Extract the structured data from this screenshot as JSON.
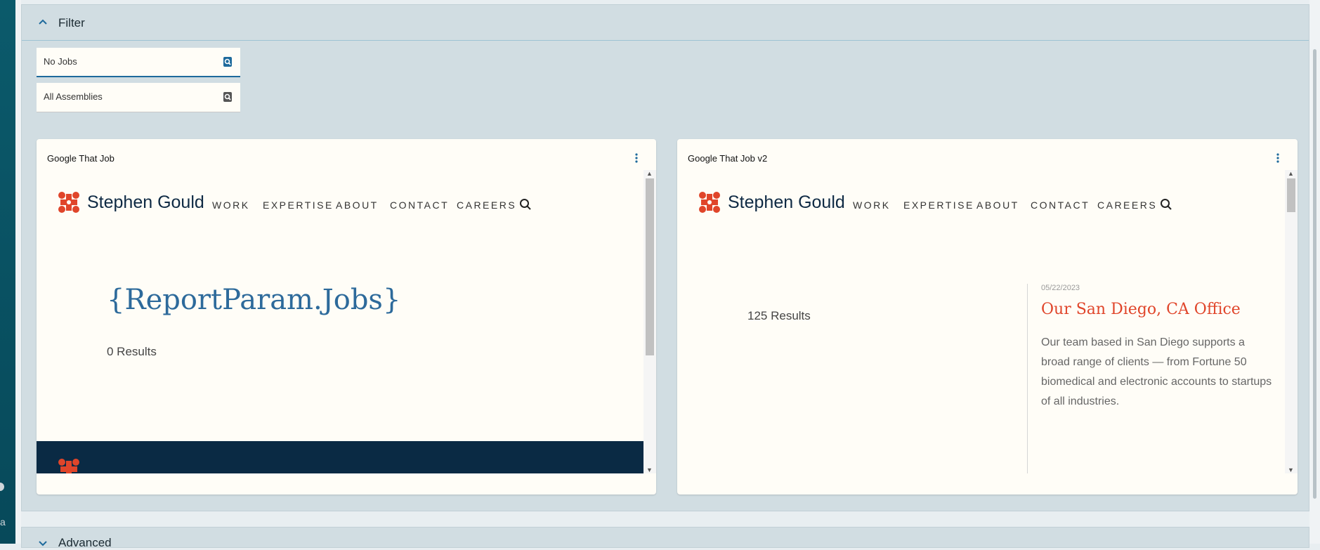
{
  "filter_panel": {
    "title": "Filter",
    "jobs_field": {
      "value": "No Jobs"
    },
    "assemblies_field": {
      "value": "All Assemblies"
    }
  },
  "cards": [
    {
      "title": "Google That Job",
      "site": {
        "brand": "Stephen Gould",
        "nav": [
          "WORK",
          "EXPERTISE",
          "ABOUT",
          "CONTACT",
          "CAREERS"
        ],
        "heading": "{ReportParam.Jobs}",
        "results": "0 Results"
      }
    },
    {
      "title": "Google That Job v2",
      "site": {
        "brand": "Stephen Gould",
        "nav": [
          "WORK",
          "EXPERTISE",
          "ABOUT",
          "CONTACT",
          "CAREERS"
        ],
        "results": "125 Results",
        "article": {
          "date": "05/22/2023",
          "title": "Our San Diego, CA Office",
          "description": "Our team based in San Diego supports a broad range of clients — from Fortune 50 biomedical and electronic accounts to startups of all industries."
        }
      }
    }
  ],
  "advanced_panel": {
    "title": "Advanced"
  },
  "colors": {
    "accent": "#1e6a9c",
    "brand_orange": "#e0452a",
    "navy": "#0f2a44",
    "panel_bg": "#d1dde2"
  }
}
